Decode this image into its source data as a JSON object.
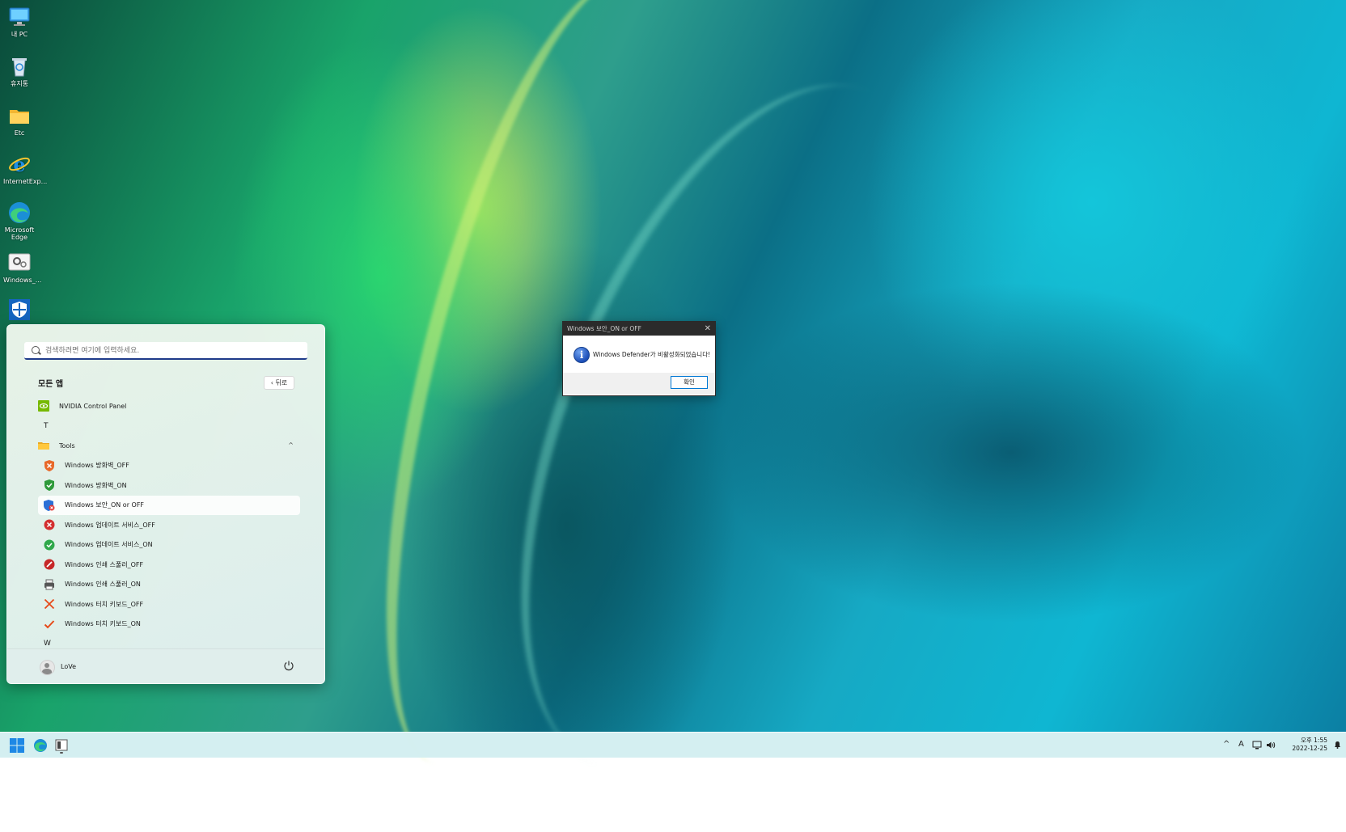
{
  "desktop": {
    "icons": [
      {
        "label": "내 PC",
        "icon": "monitor-icon"
      },
      {
        "label": "휴지통",
        "icon": "recycle-bin-icon"
      },
      {
        "label": "Etc",
        "icon": "folder-icon"
      },
      {
        "label": "InternetExp...",
        "icon": "internet-explorer-icon"
      },
      {
        "label": "Microsoft Edge",
        "icon": "edge-icon"
      },
      {
        "label": "Windows_...",
        "icon": "settings-gear-icon"
      },
      {
        "label": "",
        "icon": "windows-security-shield-icon"
      }
    ]
  },
  "start_menu": {
    "search_placeholder": "검색하려면 여기에 입력하세요.",
    "all_apps_title": "모든 앱",
    "back_label": "뒤로",
    "items": [
      {
        "type": "app",
        "label": "NVIDIA Control Panel",
        "icon": "nvidia-icon"
      },
      {
        "type": "letter",
        "label": "T"
      },
      {
        "type": "folder",
        "label": "Tools",
        "icon": "folder-icon",
        "expanded": true
      },
      {
        "type": "sub",
        "label": "Windows 방화벽_OFF",
        "icon": "shield-x-icon"
      },
      {
        "type": "sub",
        "label": "Windows 방화벽_ON",
        "icon": "shield-check-icon"
      },
      {
        "type": "sub",
        "label": "Windows 보안_ON or OFF",
        "icon": "security-toggle-icon",
        "selected": true
      },
      {
        "type": "sub",
        "label": "Windows 업데이트 서비스_OFF",
        "icon": "red-x-circle-icon"
      },
      {
        "type": "sub",
        "label": "Windows 업데이트 서비스_ON",
        "icon": "green-check-circle-icon"
      },
      {
        "type": "sub",
        "label": "Windows 인쇄 스풀러_OFF",
        "icon": "red-stop-icon"
      },
      {
        "type": "sub",
        "label": "Windows 인쇄 스풀러_ON",
        "icon": "printer-icon"
      },
      {
        "type": "sub",
        "label": "Windows 터치 키보드_OFF",
        "icon": "orange-x-icon"
      },
      {
        "type": "sub",
        "label": "Windows 터치 키보드_ON",
        "icon": "orange-check-icon"
      },
      {
        "type": "letter",
        "label": "W"
      }
    ],
    "user_name": "LoVe"
  },
  "dialog": {
    "title": "Windows 보안_ON or OFF",
    "message": "Windows Defender가 비활성화되었습니다!",
    "ok_label": "확인"
  },
  "taskbar": {
    "ime_label": "A",
    "time": "오후 1:55",
    "date": "2022-12-25"
  },
  "colors": {
    "accent": "#0078d4",
    "taskbar": "#d2eef0"
  }
}
